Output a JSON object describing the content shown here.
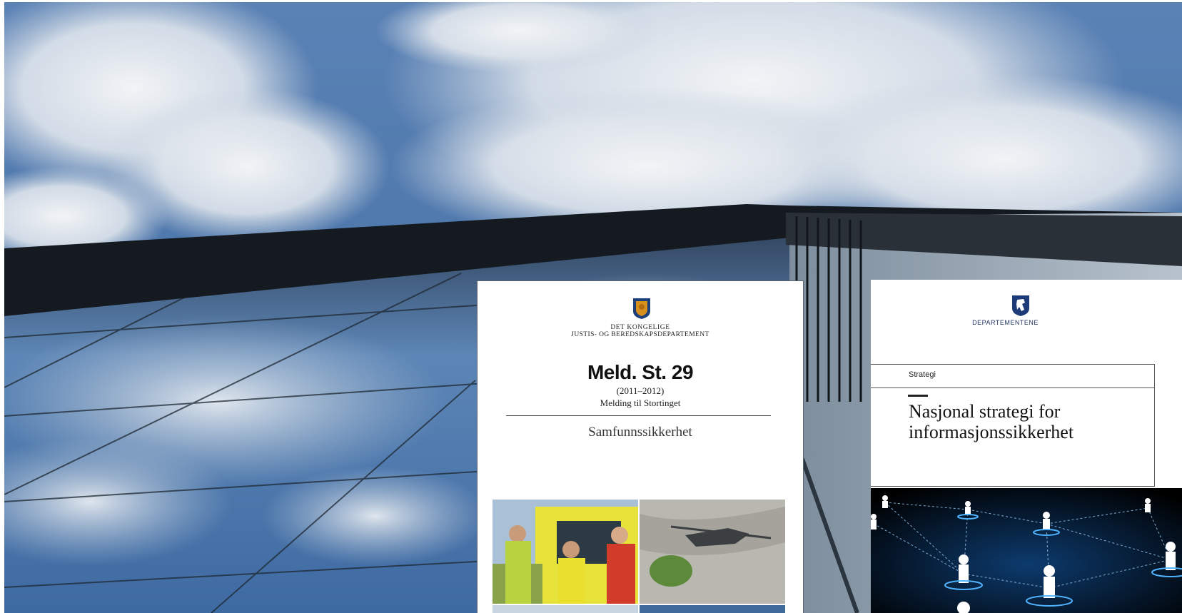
{
  "scene": {
    "background": "sky-and-glass-building-photo",
    "colors": {
      "sky": "#4f79ad",
      "cloud": "#e8ecf0",
      "building": "#151a1f",
      "glass": "#5f86b4"
    }
  },
  "doc1": {
    "crest": "norwegian-royal-crest",
    "department_line1": "DET KONGELIGE",
    "department_line2": "JUSTIS- OG BEREDSKAPSDEPARTEMENT",
    "title": "Meld. St. 29",
    "period": "(2011–2012)",
    "subtitle": "Melding til Stortinget",
    "subject": "Samfunnssikkerhet",
    "photos": [
      "police-and-rescue-workers-photo",
      "helicopter-shadow-photo"
    ]
  },
  "doc2": {
    "crest": "norwegian-lion-crest",
    "department": "DEPARTEMENTENE",
    "kind": "Strategi",
    "title_line1": "Nasjonal strategi for",
    "title_line2": "informasjonssikkerhet",
    "image": "network-people-illustration"
  }
}
